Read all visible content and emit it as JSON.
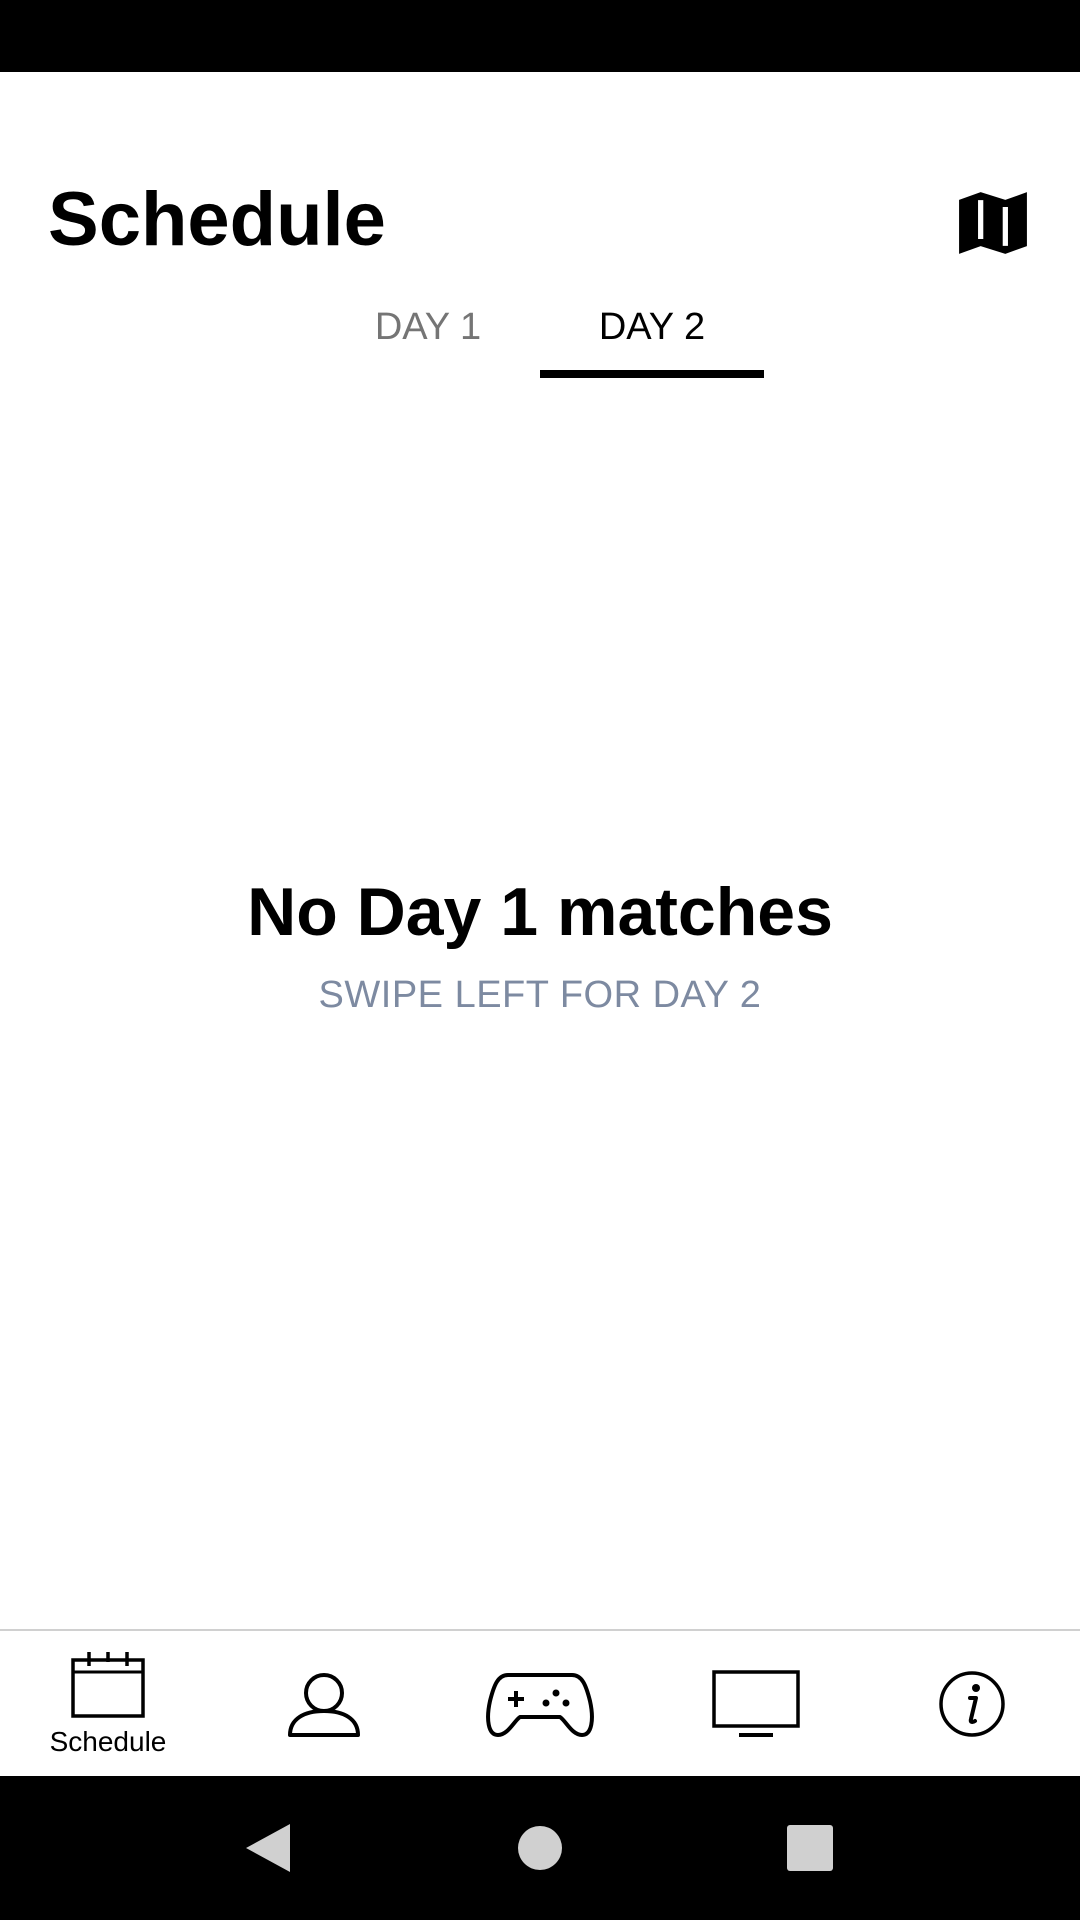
{
  "header": {
    "title": "Schedule",
    "map_icon": "map-icon"
  },
  "tabs": [
    {
      "label": "DAY 1",
      "selected": false
    },
    {
      "label": "DAY 2",
      "selected": true
    }
  ],
  "empty_state": {
    "title": "No Day 1 matches",
    "subtitle": "SWIPE LEFT FOR DAY 2"
  },
  "bottom_nav": {
    "items": [
      {
        "icon": "calendar-icon",
        "label": "Schedule",
        "selected": true
      },
      {
        "icon": "person-icon",
        "label": "",
        "selected": false
      },
      {
        "icon": "gamepad-icon",
        "label": "",
        "selected": false
      },
      {
        "icon": "monitor-icon",
        "label": "",
        "selected": false
      },
      {
        "icon": "info-icon",
        "label": "",
        "selected": false
      }
    ]
  },
  "colors": {
    "accent": "#000000",
    "tab_inactive": "#757575",
    "subtitle": "#7d8aa1",
    "bar": "#000000"
  }
}
